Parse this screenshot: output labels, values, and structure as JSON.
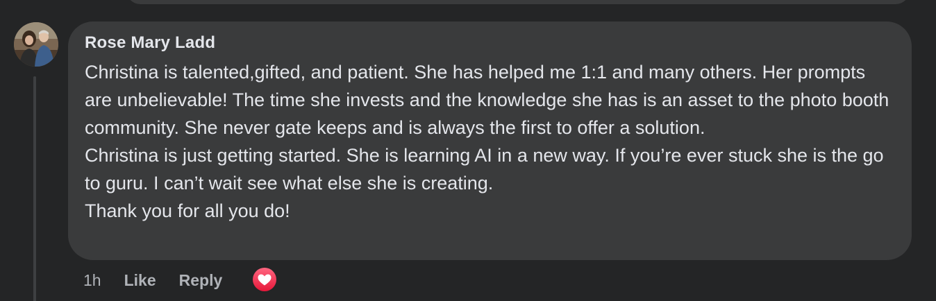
{
  "comment": {
    "author": "Rose Mary Ladd",
    "paragraphs": [
      "Christina is talented,gifted, and patient. She has helped me 1:1 and many others. Her prompts are unbelievable! The time she invests and the knowledge she has is an asset to the photo booth community. She never gate keeps and is always the first to offer a solution.",
      "Christina is just getting started. She is learning AI in a new way. If you’re ever stuck she is the go to guru. I can’t wait see what else she is creating.",
      "Thank you for all you do!"
    ],
    "reaction_icon": "love-heart-icon"
  },
  "actions": {
    "time": "1h",
    "like_label": "Like",
    "reply_label": "Reply"
  },
  "colors": {
    "background": "#242526",
    "bubble": "#3a3b3c",
    "text": "#e4e6eb",
    "secondary_text": "#b0b3b8",
    "love_reaction": "#f33e58"
  }
}
